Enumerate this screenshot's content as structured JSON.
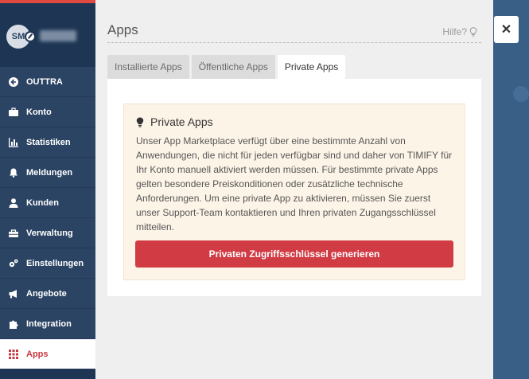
{
  "profile": {
    "initials": "SM"
  },
  "sidebar": {
    "items": [
      {
        "label": "OUTTRA",
        "icon": "arrow-circle-left-icon"
      },
      {
        "label": "Konto",
        "icon": "briefcase-icon"
      },
      {
        "label": "Statistiken",
        "icon": "bar-chart-icon"
      },
      {
        "label": "Meldungen",
        "icon": "bell-icon"
      },
      {
        "label": "Kunden",
        "icon": "user-icon"
      },
      {
        "label": "Verwaltung",
        "icon": "toolbox-icon"
      },
      {
        "label": "Einstellungen",
        "icon": "cogs-icon"
      },
      {
        "label": "Angebote",
        "icon": "megaphone-icon"
      },
      {
        "label": "Integration",
        "icon": "puzzle-icon"
      },
      {
        "label": "Apps",
        "icon": "grid-icon",
        "active": true
      }
    ]
  },
  "panel": {
    "title": "Apps",
    "help_label": "Hilfe?",
    "tabs": [
      {
        "label": "Installierte Apps"
      },
      {
        "label": "Öffentliche Apps"
      },
      {
        "label": "Private Apps",
        "active": true
      }
    ],
    "notice": {
      "title": "Private Apps",
      "text": "Unser App Marketplace verfügt über eine bestimmte Anzahl von Anwendungen, die nicht für jeden verfügbar sind und daher von TIMIFY für Ihr Konto manuell aktiviert werden müssen. Für bestimmte private Apps gelten besondere Preiskonditionen oder zusätzliche technische Anforderungen. Um eine private App zu aktivieren, müssen Sie zuerst unser Support-Team kontaktieren und Ihren privaten Zugangsschlüssel mitteilen.",
      "button_label": "Privaten Zugriffsschlüssel generieren"
    },
    "close_label": "✕"
  },
  "colors": {
    "sidebar": "#2b4463",
    "accent": "#d13b44",
    "notice_bg": "#fdf4e8"
  }
}
